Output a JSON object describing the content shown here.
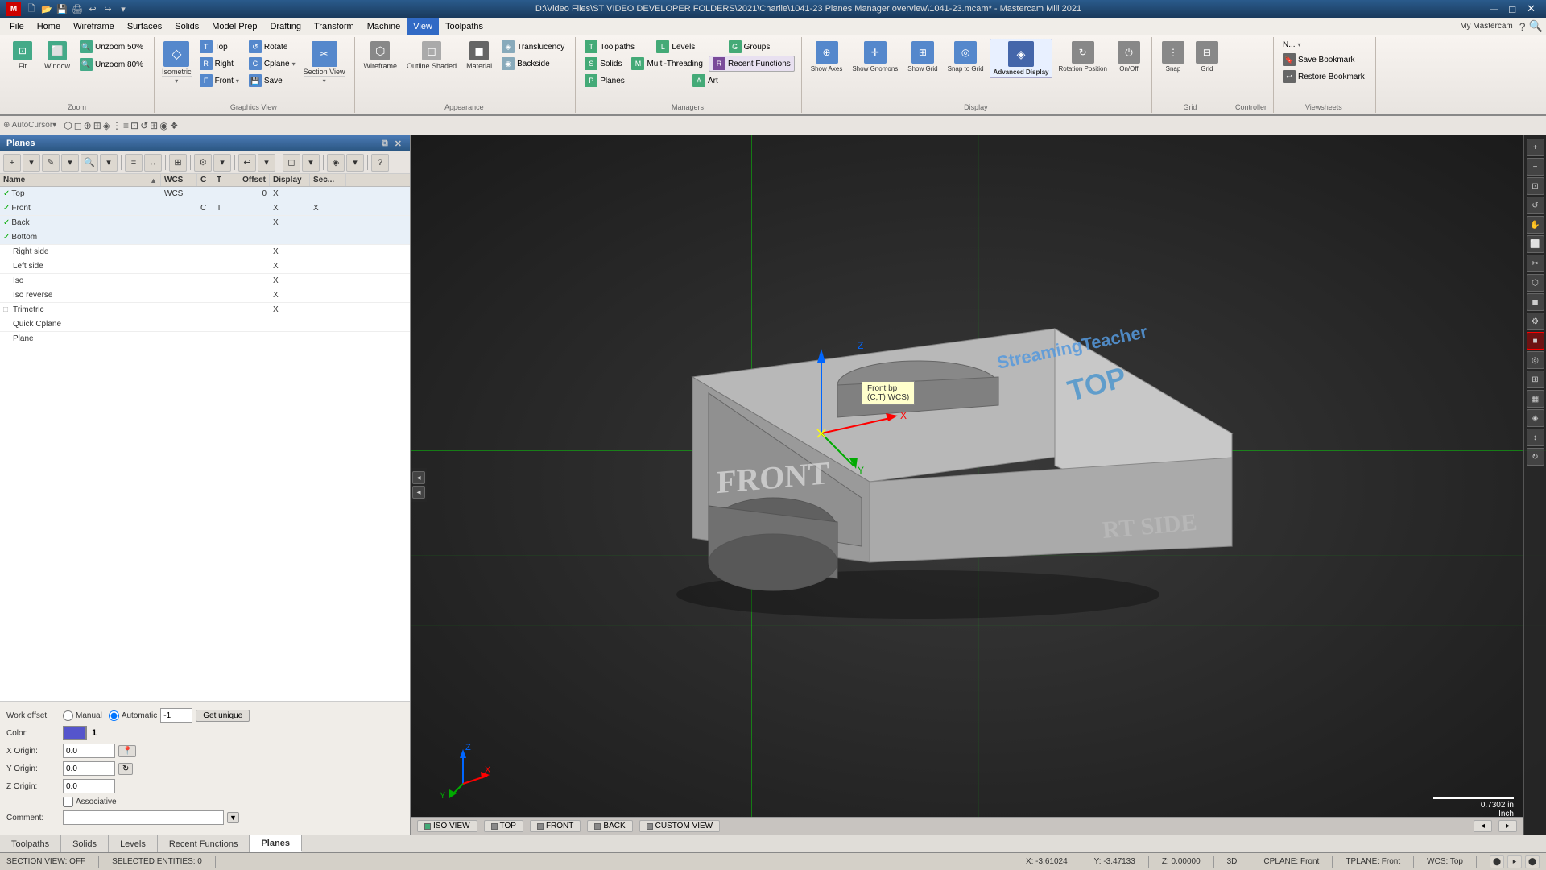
{
  "titlebar": {
    "title": "D:\\Video Files\\ST VIDEO DEVELOPER FOLDERS\\2021\\Charlie\\1041-23 Planes Manager overview\\1041-23.mcam* - Mastercam Mill 2021",
    "app_icon": "M",
    "my_mastercam": "My Mastercam",
    "close": "✕",
    "minimize": "─",
    "maximize": "□"
  },
  "menu": {
    "items": [
      "File",
      "Home",
      "Wireframe",
      "Surfaces",
      "Solids",
      "Model Prep",
      "Drafting",
      "Transform",
      "Machine",
      "View",
      "Toolpaths"
    ]
  },
  "ribbon": {
    "active_tab": "View",
    "zoom_group": {
      "label": "Zoom",
      "fit_btn": "Fit",
      "window_btn": "Window",
      "unzoom50": "Unzoom 50%",
      "unzoom80": "Unzoom 80%"
    },
    "graphics_view_group": {
      "label": "Graphics View",
      "isometric": "Isometric",
      "top": "Top",
      "front": "Front",
      "right": "Right",
      "rotate": "Rotate",
      "cplane": "Cplane",
      "save": "Save",
      "section_view": "Section View"
    },
    "appearance_group": {
      "label": "Appearance",
      "wireframe": "Wireframe",
      "outline": "Outline Shaded",
      "material": "Material",
      "translucency": "Translucency",
      "backside": "Backside"
    },
    "toolpaths_group": {
      "label": "Toolpaths",
      "toolpaths": "Toolpaths",
      "levels": "Levels",
      "groups": "Groups",
      "solids": "Solids",
      "multi_threading": "Multi-Threading",
      "recent_functions": "Recent Functions",
      "planes": "Planes",
      "art": "Art"
    },
    "display_group": {
      "label": "Display",
      "show_axes": "Show Axes",
      "show_gnomons": "Show Gnomons",
      "show_grid": "Show Grid",
      "snap_to_grid": "Snap to Grid",
      "advanced_display": "Advanced Display",
      "rotation_position": "Rotation Position",
      "on_off": "On/Off"
    },
    "managers_group": {
      "label": "Managers"
    },
    "grid_group": {
      "label": "Grid"
    },
    "controller_group": {
      "label": "Controller"
    },
    "viewsheets_group": {
      "label": "Viewsheets",
      "save_bookmark": "Save Bookmark",
      "restore_bookmark": "Restore Bookmark",
      "n_dropdown": "N..."
    }
  },
  "planes_panel": {
    "title": "Planes",
    "columns": {
      "name": "Name",
      "wcs": "WCS",
      "c": "C",
      "t": "T",
      "offset": "Offset",
      "display": "Display",
      "section": "Sec..."
    },
    "rows": [
      {
        "check": true,
        "name": "Top",
        "wcs": "WCS",
        "c": "",
        "t": "",
        "offset": "0",
        "display": "X",
        "section": ""
      },
      {
        "check": true,
        "name": "Front",
        "wcs": "",
        "c": "C",
        "t": "T",
        "offset": "",
        "display": "X",
        "section": "X"
      },
      {
        "check": true,
        "name": "Back",
        "wcs": "",
        "c": "",
        "t": "",
        "offset": "",
        "display": "X",
        "section": ""
      },
      {
        "check": true,
        "name": "Bottom",
        "wcs": "",
        "c": "",
        "t": "",
        "offset": "",
        "display": "",
        "section": ""
      },
      {
        "check": false,
        "name": "Right side",
        "wcs": "",
        "c": "",
        "t": "",
        "offset": "",
        "display": "X",
        "section": ""
      },
      {
        "check": false,
        "name": "Left side",
        "wcs": "",
        "c": "",
        "t": "",
        "offset": "",
        "display": "X",
        "section": ""
      },
      {
        "check": false,
        "name": "Iso",
        "wcs": "",
        "c": "",
        "t": "",
        "offset": "",
        "display": "X",
        "section": ""
      },
      {
        "check": false,
        "name": "Iso reverse",
        "wcs": "",
        "c": "",
        "t": "",
        "offset": "",
        "display": "X",
        "section": ""
      },
      {
        "check": false,
        "name": "Trimetric",
        "wcs": "",
        "c": "",
        "t": "",
        "offset": "",
        "display": "X",
        "section": ""
      },
      {
        "check": false,
        "name": "Quick Cplane",
        "wcs": "",
        "c": "",
        "t": "",
        "offset": "",
        "display": "",
        "section": ""
      },
      {
        "check": false,
        "name": "Plane",
        "wcs": "",
        "c": "",
        "t": "",
        "offset": "",
        "display": "",
        "section": ""
      }
    ],
    "work_offset": {
      "label": "Work offset",
      "manual": "Manual",
      "automatic": "Automatic",
      "value": "-1",
      "get_unique": "Get unique"
    },
    "color": {
      "label": "Color:",
      "value": "1"
    },
    "x_origin": {
      "label": "X Origin:",
      "value": "0.0"
    },
    "y_origin": {
      "label": "Y Origin:",
      "value": "0.0"
    },
    "z_origin": {
      "label": "Z Origin:",
      "value": "0.0"
    },
    "associative": "Associative",
    "comment": {
      "label": "Comment:"
    }
  },
  "viewport": {
    "tooltip": {
      "line1": "Front bp",
      "line2": "(C,T) WCS)"
    },
    "axes": {
      "x": "X",
      "y": "Y",
      "z": "Z"
    },
    "scale": {
      "value": "0.7302 in",
      "unit": "Inch"
    },
    "crosshairs": true
  },
  "bottom_tabs": {
    "tabs": [
      "Toolpaths",
      "Solids",
      "Levels",
      "Recent Functions",
      "Planes"
    ]
  },
  "bottom_views": {
    "iso_view": "ISO VIEW",
    "top": "TOP",
    "front": "FRONT",
    "back": "BACK",
    "custom_view": "CUSTOM VIEW"
  },
  "statusbar": {
    "section_view": "SECTION VIEW: OFF",
    "selected_entities": "SELECTED ENTITIES: 0",
    "x": "X: -3.61024",
    "y": "Y: -3.47133",
    "z": "Z: 0.00000",
    "mode": "3D",
    "cplane": "CPLANE: Front",
    "tplane": "TPLANE: Front",
    "wcs": "WCS: Top"
  },
  "colors": {
    "accent_blue": "#316AC5",
    "title_bar": "#2a5b8c",
    "active_tab": "#f8f4f0",
    "ribbon_bg": "#f0ede8",
    "panel_bg": "#f0ede8",
    "viewport_bg": "#2a2a2a",
    "green": "#00aa00",
    "red": "#cc0000"
  }
}
